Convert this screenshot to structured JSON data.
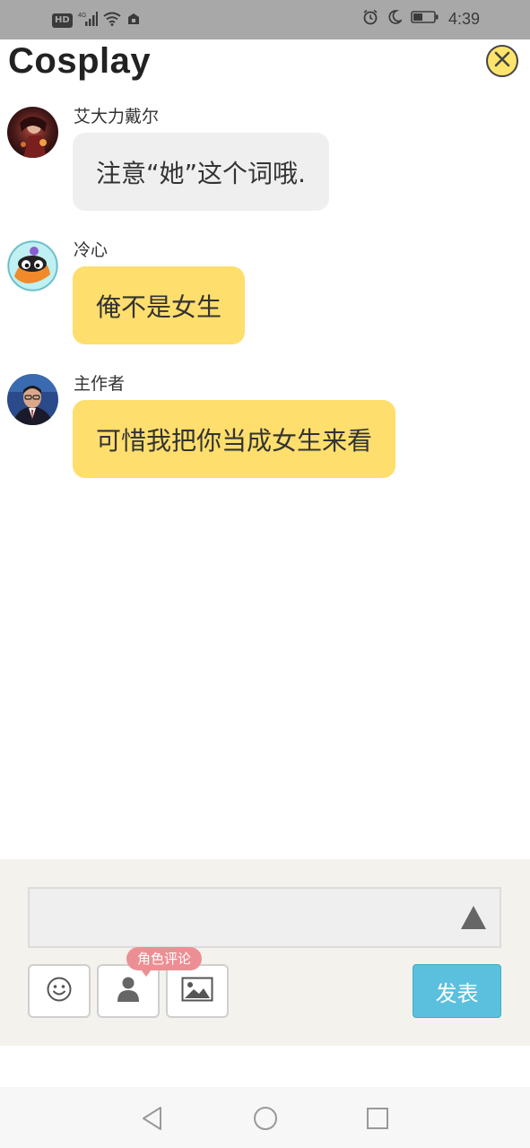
{
  "status_bar": {
    "network_badge": "HD",
    "signal_label": "4G",
    "time": "4:39",
    "icons": [
      "hd-icon",
      "signal-icon",
      "wifi-icon",
      "notification-icon",
      "alarm-icon",
      "moon-icon",
      "battery-icon"
    ]
  },
  "header": {
    "title": "Cosplay",
    "close_icon": "close-icon"
  },
  "messages": [
    {
      "sender": "艾大力戴尔",
      "text": "注意“她”这个词哦.",
      "bubble_color": "#efefef"
    },
    {
      "sender": "冷心",
      "text": "俺不是女生",
      "bubble_color": "#fede6d"
    },
    {
      "sender": "主作者",
      "text": "可惜我把你当成女生来看",
      "bubble_color": "#fede6d"
    }
  ],
  "composer": {
    "input_value": "",
    "expand_icon": "triangle-up-icon",
    "tools": [
      "emoji-icon",
      "person-icon",
      "image-icon"
    ],
    "role_tooltip": "角色评论",
    "send_label": "发表",
    "send_color": "#5bc0de"
  },
  "nav_bar": {
    "icons": [
      "back-icon",
      "home-icon",
      "recents-icon"
    ]
  }
}
